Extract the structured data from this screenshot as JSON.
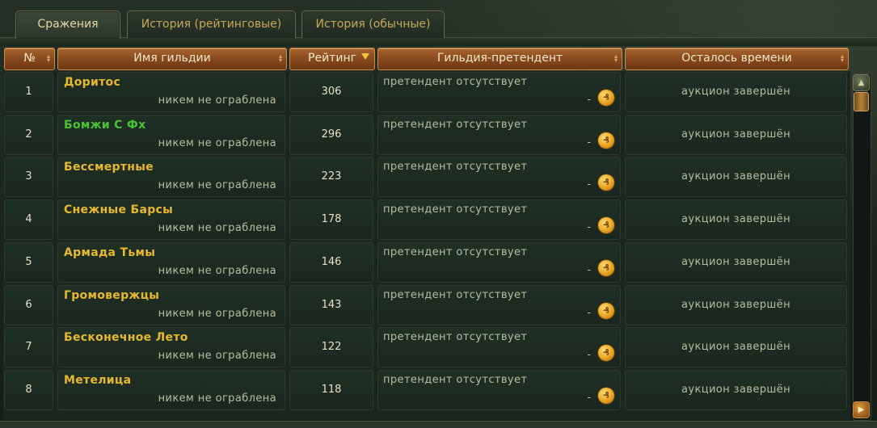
{
  "tabs": [
    {
      "label": "Сражения",
      "active": true
    },
    {
      "label": "История (рейтинговые)",
      "active": false
    },
    {
      "label": "История (обычные)",
      "active": false
    }
  ],
  "columns": {
    "num": "№",
    "guild": "Имя гильдии",
    "rating": "Рейтинг",
    "challenger": "Гильдия-претендент",
    "time": "Осталось времени"
  },
  "sort": {
    "column": "rating",
    "direction": "desc"
  },
  "rows": [
    {
      "num": "1",
      "guild": "Доритос",
      "guild_color": "#e7b82d",
      "robbed": "никем не ограблена",
      "rating": "306",
      "challenger": "претендент отсутствует",
      "bid": "-",
      "time": "аукцион завершён"
    },
    {
      "num": "2",
      "guild": "Бомжи С Фх",
      "guild_color": "#49c233",
      "robbed": "никем не ограблена",
      "rating": "296",
      "challenger": "претендент отсутствует",
      "bid": "-",
      "time": "аукцион завершён"
    },
    {
      "num": "3",
      "guild": "Бессмертные",
      "guild_color": "#e7b82d",
      "robbed": "никем не ограблена",
      "rating": "223",
      "challenger": "претендент отсутствует",
      "bid": "-",
      "time": "аукцион завершён"
    },
    {
      "num": "4",
      "guild": "Снежные Барсы",
      "guild_color": "#e7b82d",
      "robbed": "никем не ограблена",
      "rating": "178",
      "challenger": "претендент отсутствует",
      "bid": "-",
      "time": "аукцион завершён"
    },
    {
      "num": "5",
      "guild": "Армада Тьмы",
      "guild_color": "#e7b82d",
      "robbed": "никем не ограблена",
      "rating": "146",
      "challenger": "претендент отсутствует",
      "bid": "-",
      "time": "аукцион завершён"
    },
    {
      "num": "6",
      "guild": "Громовержцы",
      "guild_color": "#e7b82d",
      "robbed": "никем не ограблена",
      "rating": "143",
      "challenger": "претендент отсутствует",
      "bid": "-",
      "time": "аукцион завершён"
    },
    {
      "num": "7",
      "guild": "Бесконечное Лето",
      "guild_color": "#e7b82d",
      "robbed": "никем не ограблена",
      "rating": "122",
      "challenger": "претендент отсутствует",
      "bid": "-",
      "time": "аукцион завершён"
    },
    {
      "num": "8",
      "guild": "Метелица",
      "guild_color": "#e7b82d",
      "robbed": "никем не ограблена",
      "rating": "118",
      "challenger": "претендент отсутствует",
      "bid": "-",
      "time": "аукцион завершён"
    }
  ],
  "colors": {
    "header_bg": "#8a4c20",
    "accent_gold": "#e7b82d",
    "text_muted": "#b8bd9e",
    "green_guild": "#49c233"
  },
  "icons": {
    "coin": "gold-coin-icon",
    "sort": "sort-arrow-icon",
    "scroll_up": "scroll-up-icon",
    "scroll_down": "scroll-down-icon"
  }
}
